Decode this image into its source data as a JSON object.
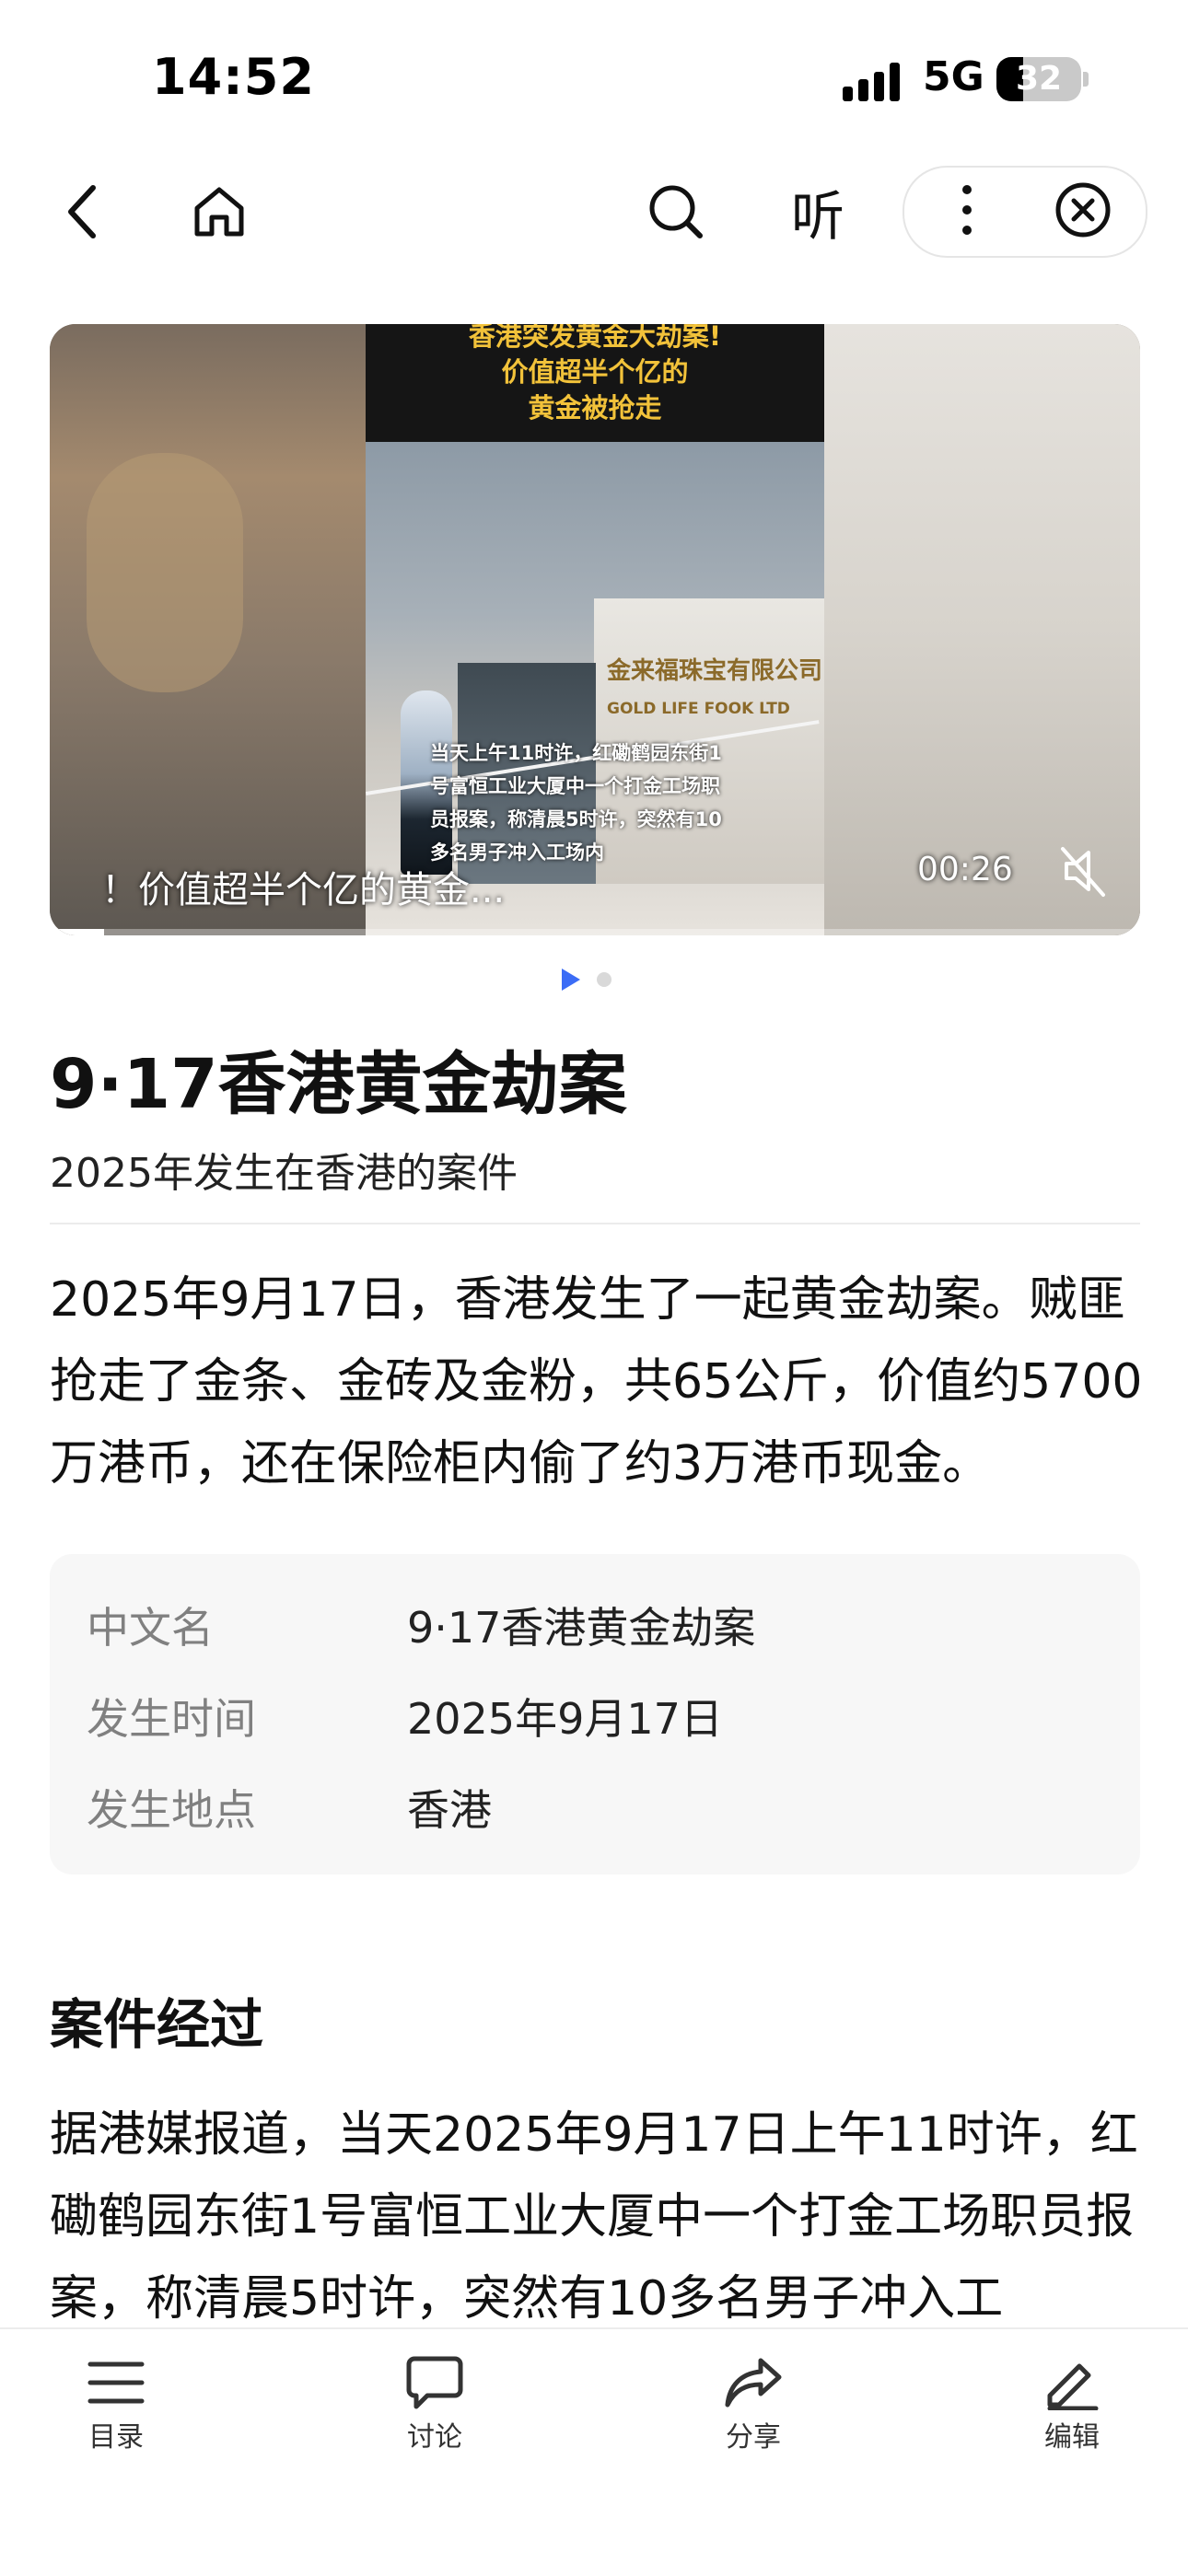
{
  "status_bar": {
    "time": "14:52",
    "network": "5G",
    "battery": "32",
    "battery_level": 0.32
  },
  "nav": {
    "listen_label": "听"
  },
  "video": {
    "overlay_title": "香港突发黄金大劫案!\n价值超半个亿的\n黄金被抢走",
    "sign_cn": "金来福珠宝有限公司",
    "sign_en": "GOLD LIFE FOOK LTD",
    "caption": "当天上午11时许，红磡鹤园东街1\n号富恒工业大厦中一个打金工场职\n员报案，称清晨5时许，突然有10\n多名男子冲入工场内",
    "title": "！价值超半个亿的黄金...",
    "duration": "00:26",
    "progress": 0.05
  },
  "article": {
    "title": "9·17香港黄金劫案",
    "subtitle": "2025年发生在香港的案件",
    "summary": "2025年9月17日，香港发生了一起黄金劫案。贼匪抢走了金条、金砖及金粉，共65公斤，价值约5700万港币，还在保险柜内偷了约3万港币现金。",
    "info": [
      {
        "label": "中文名",
        "value": "9·17香港黄金劫案"
      },
      {
        "label": "发生时间",
        "value": "2025年9月17日"
      },
      {
        "label": "发生地点",
        "value": "香港"
      }
    ],
    "section_title": "案件经过",
    "section_body": "据港媒报道，当天2025年9月17日上午11时许，红磡鹤园东街1号富恒工业大厦中一个打金工场职员报案，称清晨5时许，突然有10多名男子冲入工"
  },
  "bottom_bar": {
    "toc": "目录",
    "discuss": "讨论",
    "share": "分享",
    "edit": "编辑"
  },
  "colors": {
    "accent": "#3b6cf6",
    "caption_yellow": "#f2c23a"
  }
}
